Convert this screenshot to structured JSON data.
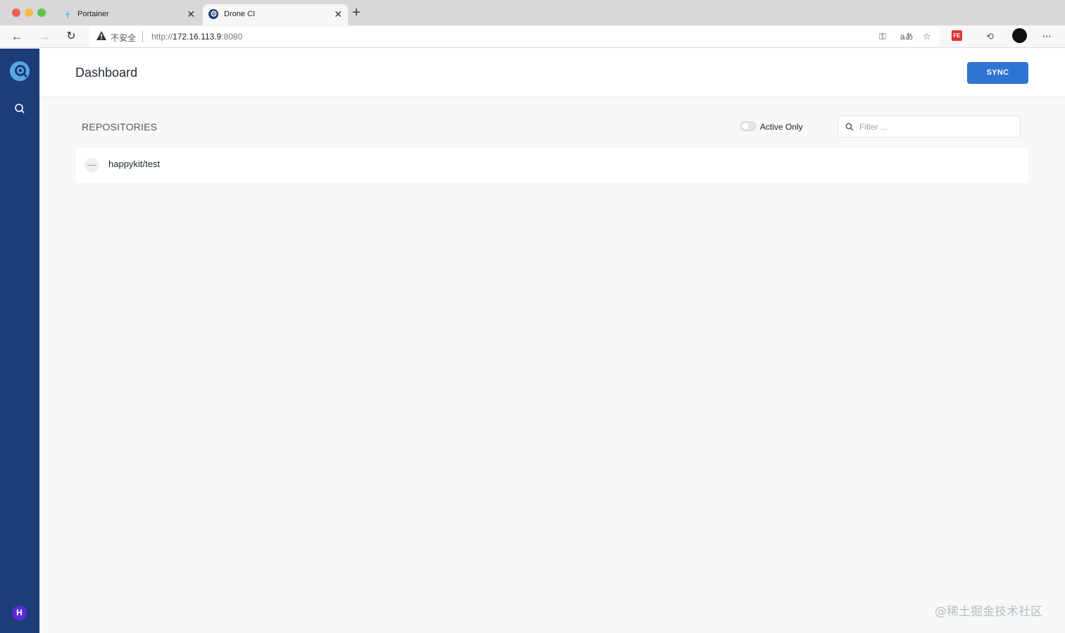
{
  "browser": {
    "tabs": [
      {
        "title": "Portainer",
        "active": false
      },
      {
        "title": "Drone CI",
        "active": true
      }
    ],
    "address": {
      "security_label": "不安全",
      "url_prefix": "http://",
      "url_host": "172.16.113.9",
      "url_port": ":8080"
    },
    "toolbar_icons": [
      "key-icon",
      "translate-icon",
      "favorite-add-icon",
      "fe-extension-icon",
      "history-icon",
      "profile-icon",
      "more-icon"
    ]
  },
  "app": {
    "sidebar": {
      "logo": "drone-logo-icon",
      "search": "search-icon",
      "avatar_initial": "H"
    },
    "header": {
      "title": "Dashboard",
      "sync_label": "SYNC"
    },
    "repositories": {
      "heading": "REPOSITORIES",
      "active_only_label": "Active Only",
      "active_only_on": false,
      "filter_placeholder": "Filter ...",
      "items": [
        {
          "name": "happykit/test"
        }
      ]
    },
    "colors": {
      "sidebar": "#1c3d7a",
      "accent": "#2f73d5",
      "avatar": "#5b2bd6"
    }
  },
  "watermark": "@稀土掘金技术社区"
}
